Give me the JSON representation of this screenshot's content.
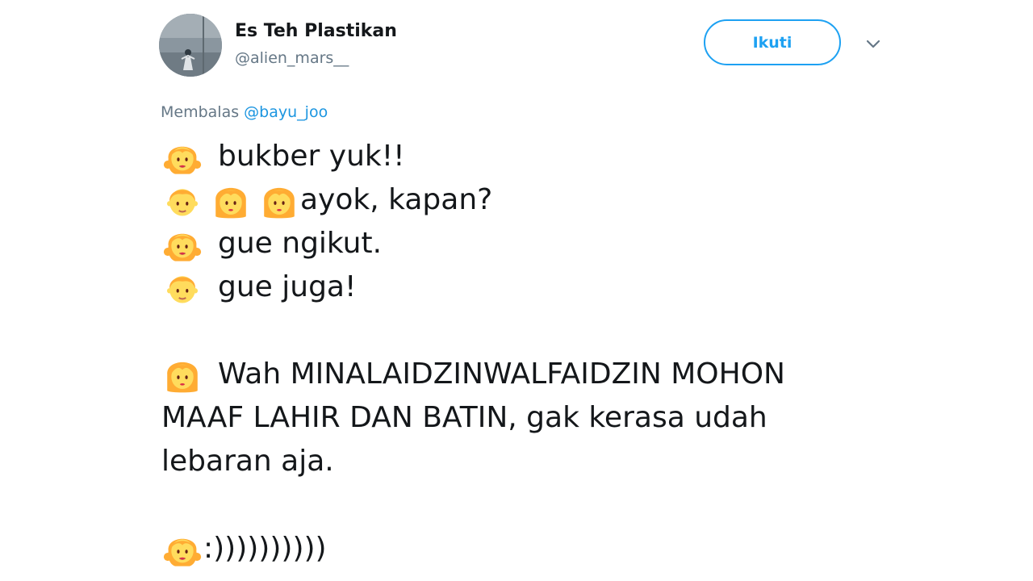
{
  "user": {
    "display_name": "Es Teh Plastikan",
    "handle": "@alien_mars__",
    "avatar_icon": "profile-photo"
  },
  "header": {
    "follow_label": "Ikuti",
    "menu_icon": "chevron-down-icon"
  },
  "reply": {
    "prefix": "Membalas",
    "mention": "@bayu_joo"
  },
  "tweet": {
    "line1": "bukber yuk!!",
    "line2": "ayok, kapan?",
    "line3": "gue ngikut.",
    "line4": "gue juga!",
    "para2_line1": "Wah MINALAIDZINWALFAIDZIN MOHON",
    "para2_line2": "MAAF LAHIR DAN BATIN, gak kerasa udah",
    "para2_line3": "lebaran aja.",
    "para3": ":))))))))))"
  },
  "emojis": {
    "girl": "girl-emoji",
    "boy": "boy-emoji",
    "woman": "woman-emoji"
  },
  "colors": {
    "accent": "#1da1f2",
    "link": "#1b95e0",
    "muted": "#657786",
    "text": "#14171a"
  }
}
